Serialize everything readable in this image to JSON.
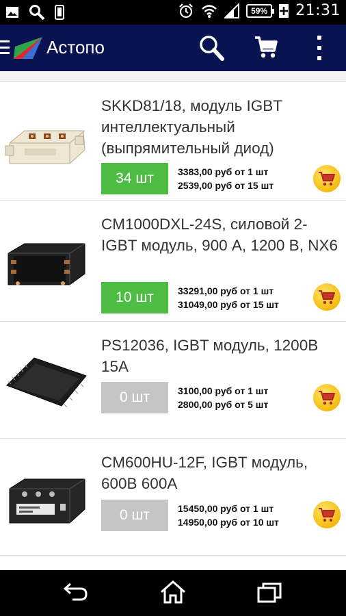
{
  "status_bar": {
    "time": "21:31",
    "battery": "59%",
    "icons": [
      "image-icon",
      "search-icon",
      "phone-icon",
      "alarm-icon",
      "wifi-icon",
      "signal-icon",
      "battery-icon"
    ]
  },
  "app_bar": {
    "title": "Астопо",
    "icons": [
      "menu-icon",
      "logo",
      "search-icon",
      "cart-icon",
      "more-icon"
    ],
    "background": "#0a1352"
  },
  "products": [
    {
      "title": "SKKD81/18, модуль IGBT интеллектуальный (выпрямительный диод)",
      "stock": "34 шт",
      "stock_color": "green",
      "price1": "3383,00 руб от 1 шт",
      "price2": "2539,00 руб от 15 шт"
    },
    {
      "title": "CM1000DXL-24S, силовой 2-IGBT модуль, 900 А, 1200 В, NX6",
      "stock": "10 шт",
      "stock_color": "green",
      "price1": "33291,00 руб от 1 шт",
      "price2": "31049,00 руб от 15 шт"
    },
    {
      "title": "PS12036, IGBT модуль, 1200В 15А",
      "stock": "0 шт",
      "stock_color": "grey",
      "price1": "3100,00 руб от 1 шт",
      "price2": "2800,00 руб от 5 шт"
    },
    {
      "title": "CM600HU-12F, IGBT модуль, 600В 600А",
      "stock": "0 шт",
      "stock_color": "grey",
      "price1": "15450,00 руб от 1 шт",
      "price2": "14950,00 руб от 10 шт"
    }
  ],
  "colors": {
    "in_stock": "#4dbd44",
    "out_of_stock": "#c5c5c5",
    "cart_button": "#f7c21a"
  }
}
